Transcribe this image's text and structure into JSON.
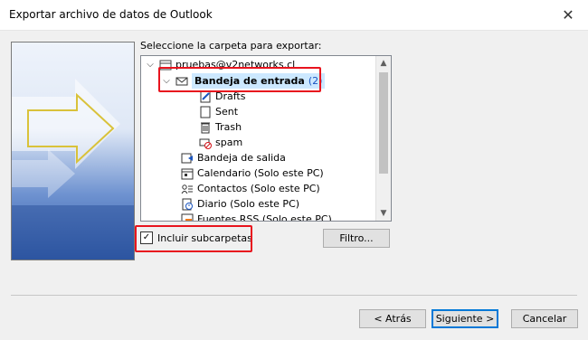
{
  "window": {
    "title": "Exportar archivo de datos de Outlook",
    "close_icon": "close-icon"
  },
  "prompt": "Seleccione la carpeta para exportar:",
  "tree": {
    "account": "pruebas@v2networks.cl",
    "inbox": {
      "label": "Bandeja de entrada",
      "count": "(2)"
    },
    "inbox_children": [
      "Drafts",
      "Sent",
      "Trash",
      "spam"
    ],
    "folders": [
      "Bandeja de salida",
      "Calendario (Solo este PC)",
      "Contactos (Solo este PC)",
      "Diario (Solo este PC)",
      "Fuentes RSS (Solo este PC)"
    ]
  },
  "include_subfolders": {
    "label": "Incluir subcarpetas",
    "checked": true
  },
  "buttons": {
    "filter": "Filtro...",
    "back": "< Atrás",
    "next": "Siguiente >",
    "cancel": "Cancelar"
  },
  "colors": {
    "highlight": "#e8141e",
    "selection": "#cce8ff",
    "count": "#1a55c0",
    "default_button_border": "#0078d7"
  }
}
